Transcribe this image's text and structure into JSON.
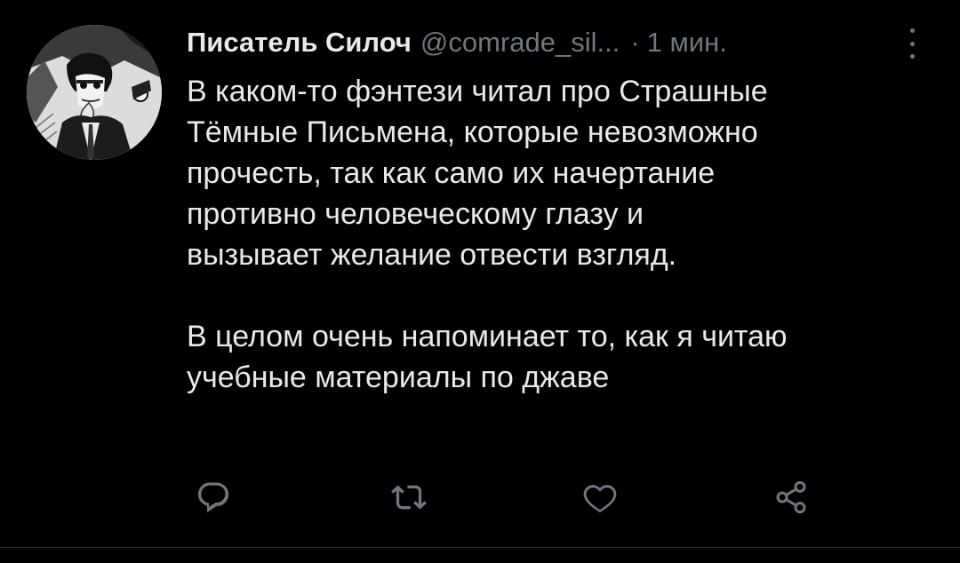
{
  "tweet": {
    "author": {
      "display_name": "Писатель Силоч",
      "handle": "@comrade_sil...",
      "avatar_icon": "avatar-image"
    },
    "separator": "·",
    "time": "1 мин.",
    "menu_icon": "more-vertical-icon",
    "text": {
      "paragraph1": [
        "В каком-то фэнтези читал про Страшные",
        "Тёмные Письмена, которые невозможно",
        "прочесть, так как само их начертание",
        "противно человеческому глазу и",
        "вызывает желание отвести взгляд."
      ],
      "paragraph2": [
        "В целом очень напоминает то, как я читаю",
        "учебные материалы по джаве"
      ]
    },
    "actions": {
      "reply_icon": "reply-icon",
      "retweet_icon": "retweet-icon",
      "like_icon": "heart-icon",
      "share_icon": "share-icon"
    }
  },
  "colors": {
    "background": "#000000",
    "text_primary": "#e7e9ea",
    "text_secondary": "#71767b",
    "divider": "#2f3336"
  }
}
